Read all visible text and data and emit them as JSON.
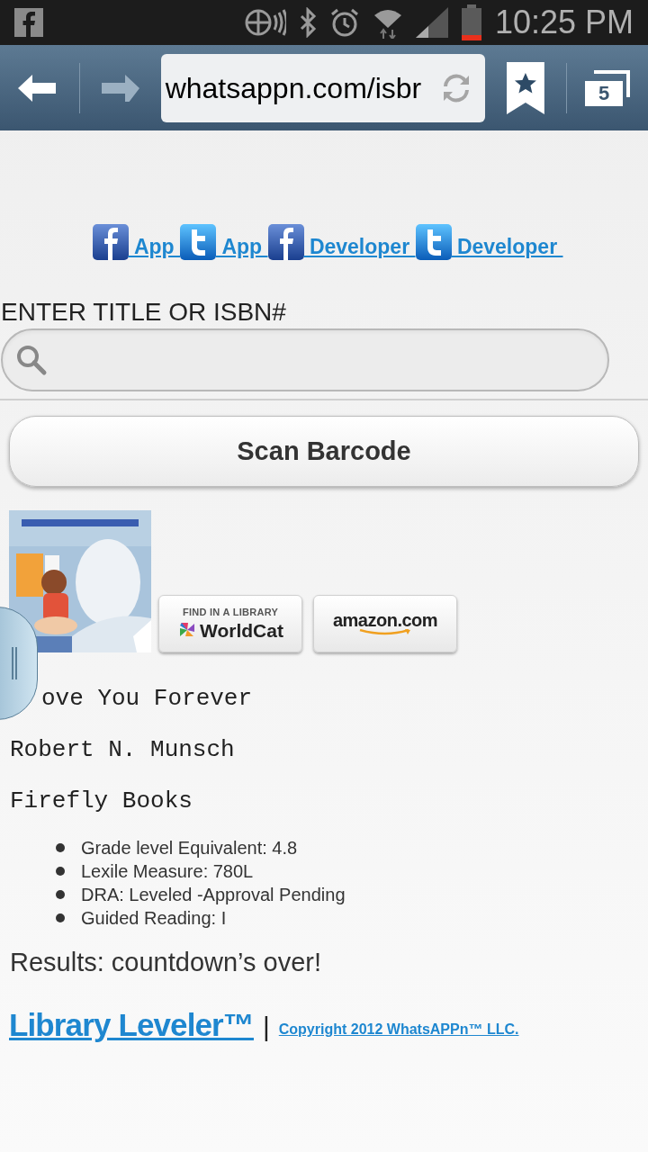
{
  "status_bar": {
    "time": "10:25 PM"
  },
  "browser_toolbar": {
    "url": "whatsappn.com/isbr",
    "tab_count": "5"
  },
  "social_links": [
    {
      "kind": "facebook",
      "label": "App"
    },
    {
      "kind": "twitter",
      "label": "App"
    },
    {
      "kind": "facebook",
      "label": "Developer"
    },
    {
      "kind": "twitter",
      "label": "Developer"
    }
  ],
  "search": {
    "label": "ENTER TITLE OR ISBN#"
  },
  "scan_button": "Scan Barcode",
  "book": {
    "worldcat": {
      "top": "FIND IN A LIBRARY",
      "name": "WorldCat"
    },
    "amazon": "amazon.com",
    "title": "ove You Forever",
    "author": "Robert N. Munsch",
    "publisher": "Firefly Books",
    "levels": [
      "Grade level Equivalent: 4.8",
      "Lexile Measure: 780L",
      "DRA: Leveled -Approval Pending",
      "Guided Reading: I"
    ]
  },
  "result": "Results: countdown’s over!",
  "footer": {
    "brand": "Library Leveler™",
    "separator": "|",
    "copyright": "Copyright 2012 WhatsAPPn™ LLC."
  }
}
